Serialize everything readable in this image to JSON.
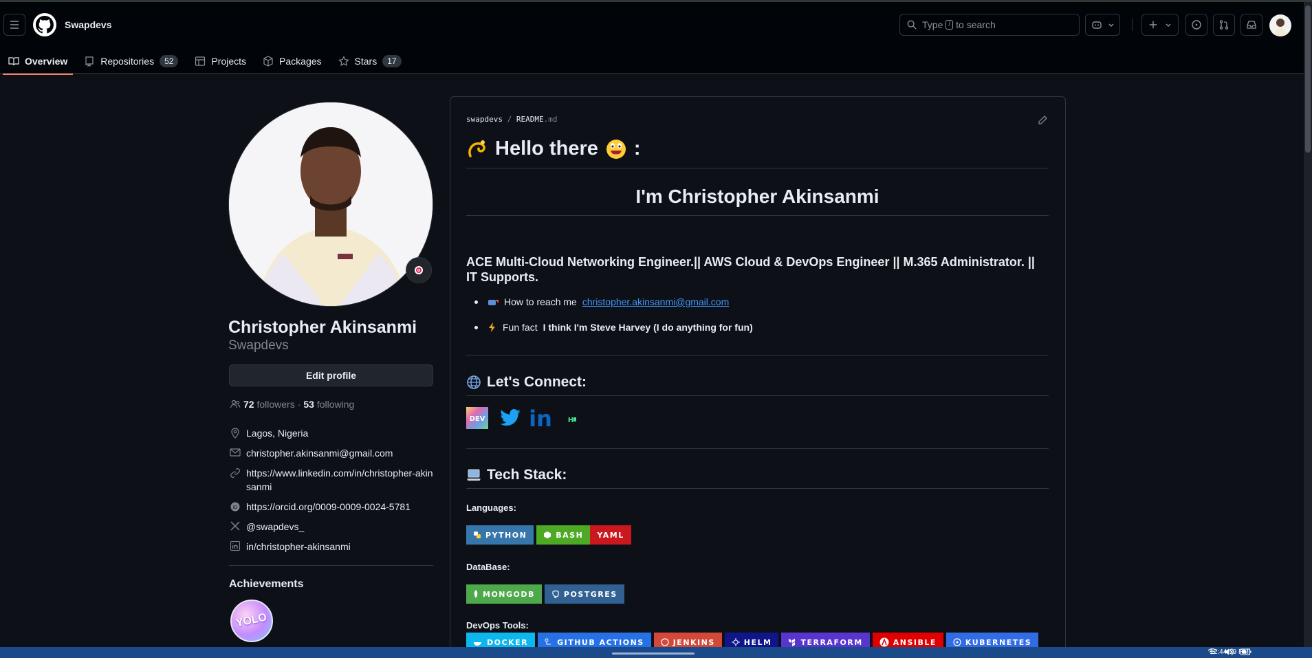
{
  "header": {
    "username": "Swapdevs",
    "search_placeholder_pre": "Type",
    "search_key": "/",
    "search_placeholder_post": "to search"
  },
  "tabs": [
    {
      "label": "Overview",
      "count": ""
    },
    {
      "label": "Repositories",
      "count": "52"
    },
    {
      "label": "Projects",
      "count": ""
    },
    {
      "label": "Packages",
      "count": ""
    },
    {
      "label": "Stars",
      "count": "17"
    }
  ],
  "profile": {
    "name": "Christopher Akinsanmi",
    "login": "Swapdevs",
    "edit_label": "Edit profile",
    "followers_count": "72",
    "followers_label": "followers",
    "sep": "·",
    "following_count": "53",
    "following_label": "following",
    "location": "Lagos, Nigeria",
    "email": "christopher.akinsanmi@gmail.com",
    "website": "https://www.linkedin.com/in/christopher-akinsanmi",
    "orcid": "https://orcid.org/0009-0009-0024-5781",
    "twitter": "@swapdevs_",
    "linkedin": "in/christopher-akinsanmi",
    "achievements_title": "Achievements",
    "badge_text": "YOLO"
  },
  "readme": {
    "crumb_owner": "swapdevs",
    "crumb_sep": "/",
    "crumb_file": "README",
    "crumb_ext": ".md",
    "heading": "Hello there",
    "heading_suffix": ":",
    "name_heading": "I'm Christopher Akinsanmi",
    "tagline": "ACE Multi-Cloud Networking Engineer.|| AWS Cloud & DevOps Engineer || M.365 Administrator. || IT Supports.",
    "reach_label": "How to reach me",
    "reach_email": "christopher.akinsanmi@gmail.com",
    "fun_label": "Fun fact",
    "fun_text": "I think I'm Steve Harvey (I do anything for fun)",
    "connect_heading": "Let's Connect:",
    "tech_heading": "Tech Stack:",
    "languages_label": "Languages:",
    "database_label": "DataBase:",
    "devops_label": "DevOps Tools:",
    "languages": [
      {
        "label": "PYTHON",
        "color": "#3776ab"
      },
      {
        "label": "BASH",
        "color": "#4eaa25"
      },
      {
        "label": "YAML",
        "color": "#cb171e"
      }
    ],
    "databases": [
      {
        "label": "MONGODB",
        "color": "#4ea94b"
      },
      {
        "label": "POSTGRES",
        "color": "#316192"
      }
    ],
    "devops": [
      {
        "label": "DOCKER",
        "color": "#0db7ed"
      },
      {
        "label": "GITHUB ACTIONS",
        "color": "#2671e5"
      },
      {
        "label": "JENKINS",
        "color": "#d24939"
      },
      {
        "label": "HELM",
        "color": "#0f1689"
      },
      {
        "label": "TERRAFORM",
        "color": "#5835cc"
      },
      {
        "label": "ANSIBLE",
        "color": "#e00000"
      },
      {
        "label": "KUBERNETES",
        "color": "#326ce5"
      }
    ]
  },
  "taskbar": {
    "time": "12:44:59 PM"
  }
}
